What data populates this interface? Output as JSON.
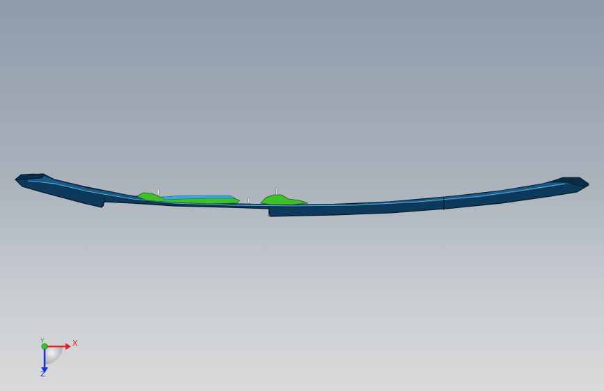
{
  "viewport": {
    "background_top": "#8f9bab",
    "background_bottom": "#d9dadb"
  },
  "model": {
    "part_color": "#0d3a5c",
    "edge_color": "#061826",
    "highlight_green": "#3fbf2a",
    "highlight_cyan": "#3aa6d8"
  },
  "triad": {
    "x_label": "X",
    "y_label": "Y",
    "z_label": "Z",
    "x_color": "#e0241b",
    "y_color": "#2aa02a",
    "z_color": "#1c2fd6"
  }
}
